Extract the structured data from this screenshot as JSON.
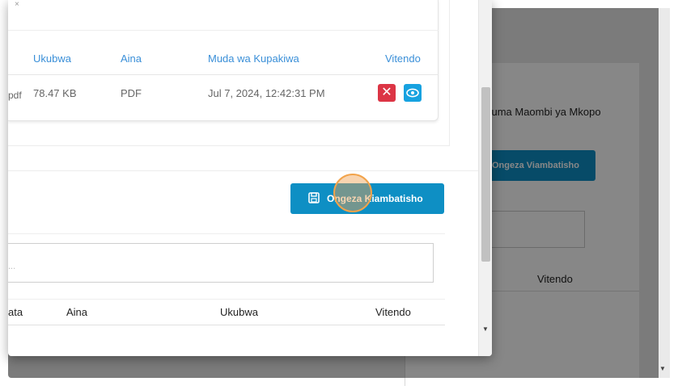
{
  "background": {
    "title": "Tuma Maombi ya Mkopo",
    "add_button": "Ongeza Viambatisho",
    "table_header_actions": "Vitendo"
  },
  "uploaded_files": {
    "headers": {
      "size": "Ukubwa",
      "type": "Aina",
      "upload_time": "Muda wa Kupakiwa",
      "actions": "Vitendo"
    },
    "rows": [
      {
        "name_fragment": "pdf",
        "size": "78.47 KB",
        "type": "PDF",
        "upload_time": "Jul 7, 2024, 12:42:31 PM"
      }
    ]
  },
  "add_attachment_button": {
    "label": "Ongeza Kiambatisho",
    "icon": "save-icon"
  },
  "attachments_table": {
    "search_placeholder": "...",
    "headers": {
      "name_fragment": "ata",
      "type": "Aina",
      "size": "Ukubwa",
      "actions": "Vitendo"
    }
  },
  "colors": {
    "primary": "#0e8fc4",
    "danger": "#dc3545",
    "info": "#17a2e0",
    "link": "#3a8fd8"
  }
}
